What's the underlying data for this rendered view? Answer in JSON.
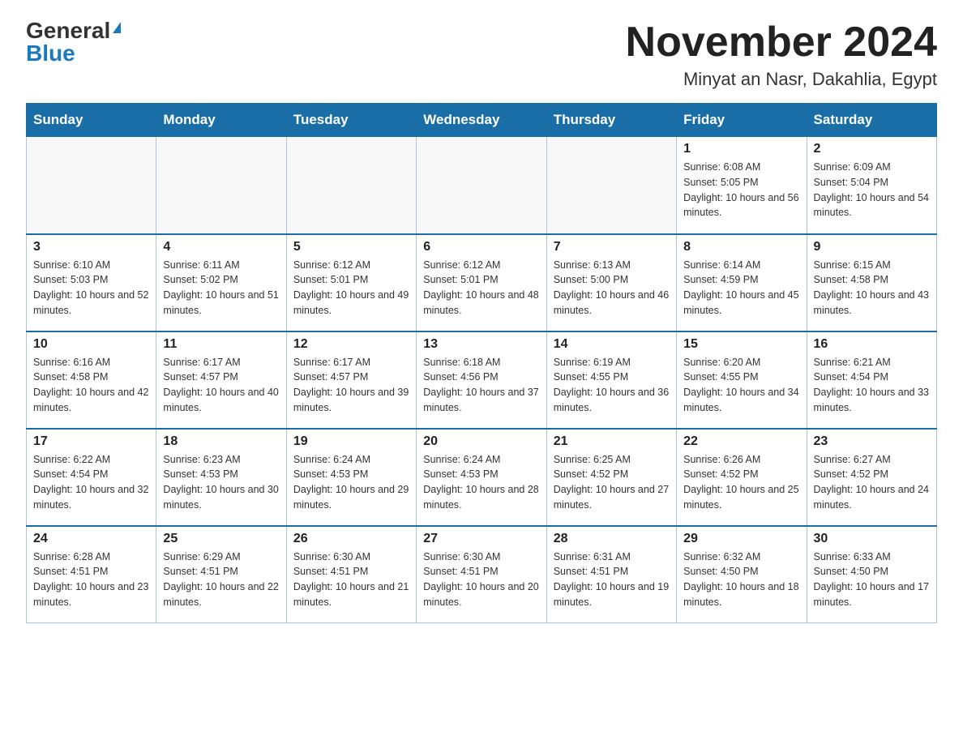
{
  "logo": {
    "general": "General",
    "blue": "Blue"
  },
  "title": {
    "month": "November 2024",
    "location": "Minyat an Nasr, Dakahlia, Egypt"
  },
  "headers": [
    "Sunday",
    "Monday",
    "Tuesday",
    "Wednesday",
    "Thursday",
    "Friday",
    "Saturday"
  ],
  "weeks": [
    [
      {
        "day": "",
        "info": ""
      },
      {
        "day": "",
        "info": ""
      },
      {
        "day": "",
        "info": ""
      },
      {
        "day": "",
        "info": ""
      },
      {
        "day": "",
        "info": ""
      },
      {
        "day": "1",
        "info": "Sunrise: 6:08 AM\nSunset: 5:05 PM\nDaylight: 10 hours and 56 minutes."
      },
      {
        "day": "2",
        "info": "Sunrise: 6:09 AM\nSunset: 5:04 PM\nDaylight: 10 hours and 54 minutes."
      }
    ],
    [
      {
        "day": "3",
        "info": "Sunrise: 6:10 AM\nSunset: 5:03 PM\nDaylight: 10 hours and 52 minutes."
      },
      {
        "day": "4",
        "info": "Sunrise: 6:11 AM\nSunset: 5:02 PM\nDaylight: 10 hours and 51 minutes."
      },
      {
        "day": "5",
        "info": "Sunrise: 6:12 AM\nSunset: 5:01 PM\nDaylight: 10 hours and 49 minutes."
      },
      {
        "day": "6",
        "info": "Sunrise: 6:12 AM\nSunset: 5:01 PM\nDaylight: 10 hours and 48 minutes."
      },
      {
        "day": "7",
        "info": "Sunrise: 6:13 AM\nSunset: 5:00 PM\nDaylight: 10 hours and 46 minutes."
      },
      {
        "day": "8",
        "info": "Sunrise: 6:14 AM\nSunset: 4:59 PM\nDaylight: 10 hours and 45 minutes."
      },
      {
        "day": "9",
        "info": "Sunrise: 6:15 AM\nSunset: 4:58 PM\nDaylight: 10 hours and 43 minutes."
      }
    ],
    [
      {
        "day": "10",
        "info": "Sunrise: 6:16 AM\nSunset: 4:58 PM\nDaylight: 10 hours and 42 minutes."
      },
      {
        "day": "11",
        "info": "Sunrise: 6:17 AM\nSunset: 4:57 PM\nDaylight: 10 hours and 40 minutes."
      },
      {
        "day": "12",
        "info": "Sunrise: 6:17 AM\nSunset: 4:57 PM\nDaylight: 10 hours and 39 minutes."
      },
      {
        "day": "13",
        "info": "Sunrise: 6:18 AM\nSunset: 4:56 PM\nDaylight: 10 hours and 37 minutes."
      },
      {
        "day": "14",
        "info": "Sunrise: 6:19 AM\nSunset: 4:55 PM\nDaylight: 10 hours and 36 minutes."
      },
      {
        "day": "15",
        "info": "Sunrise: 6:20 AM\nSunset: 4:55 PM\nDaylight: 10 hours and 34 minutes."
      },
      {
        "day": "16",
        "info": "Sunrise: 6:21 AM\nSunset: 4:54 PM\nDaylight: 10 hours and 33 minutes."
      }
    ],
    [
      {
        "day": "17",
        "info": "Sunrise: 6:22 AM\nSunset: 4:54 PM\nDaylight: 10 hours and 32 minutes."
      },
      {
        "day": "18",
        "info": "Sunrise: 6:23 AM\nSunset: 4:53 PM\nDaylight: 10 hours and 30 minutes."
      },
      {
        "day": "19",
        "info": "Sunrise: 6:24 AM\nSunset: 4:53 PM\nDaylight: 10 hours and 29 minutes."
      },
      {
        "day": "20",
        "info": "Sunrise: 6:24 AM\nSunset: 4:53 PM\nDaylight: 10 hours and 28 minutes."
      },
      {
        "day": "21",
        "info": "Sunrise: 6:25 AM\nSunset: 4:52 PM\nDaylight: 10 hours and 27 minutes."
      },
      {
        "day": "22",
        "info": "Sunrise: 6:26 AM\nSunset: 4:52 PM\nDaylight: 10 hours and 25 minutes."
      },
      {
        "day": "23",
        "info": "Sunrise: 6:27 AM\nSunset: 4:52 PM\nDaylight: 10 hours and 24 minutes."
      }
    ],
    [
      {
        "day": "24",
        "info": "Sunrise: 6:28 AM\nSunset: 4:51 PM\nDaylight: 10 hours and 23 minutes."
      },
      {
        "day": "25",
        "info": "Sunrise: 6:29 AM\nSunset: 4:51 PM\nDaylight: 10 hours and 22 minutes."
      },
      {
        "day": "26",
        "info": "Sunrise: 6:30 AM\nSunset: 4:51 PM\nDaylight: 10 hours and 21 minutes."
      },
      {
        "day": "27",
        "info": "Sunrise: 6:30 AM\nSunset: 4:51 PM\nDaylight: 10 hours and 20 minutes."
      },
      {
        "day": "28",
        "info": "Sunrise: 6:31 AM\nSunset: 4:51 PM\nDaylight: 10 hours and 19 minutes."
      },
      {
        "day": "29",
        "info": "Sunrise: 6:32 AM\nSunset: 4:50 PM\nDaylight: 10 hours and 18 minutes."
      },
      {
        "day": "30",
        "info": "Sunrise: 6:33 AM\nSunset: 4:50 PM\nDaylight: 10 hours and 17 minutes."
      }
    ]
  ]
}
